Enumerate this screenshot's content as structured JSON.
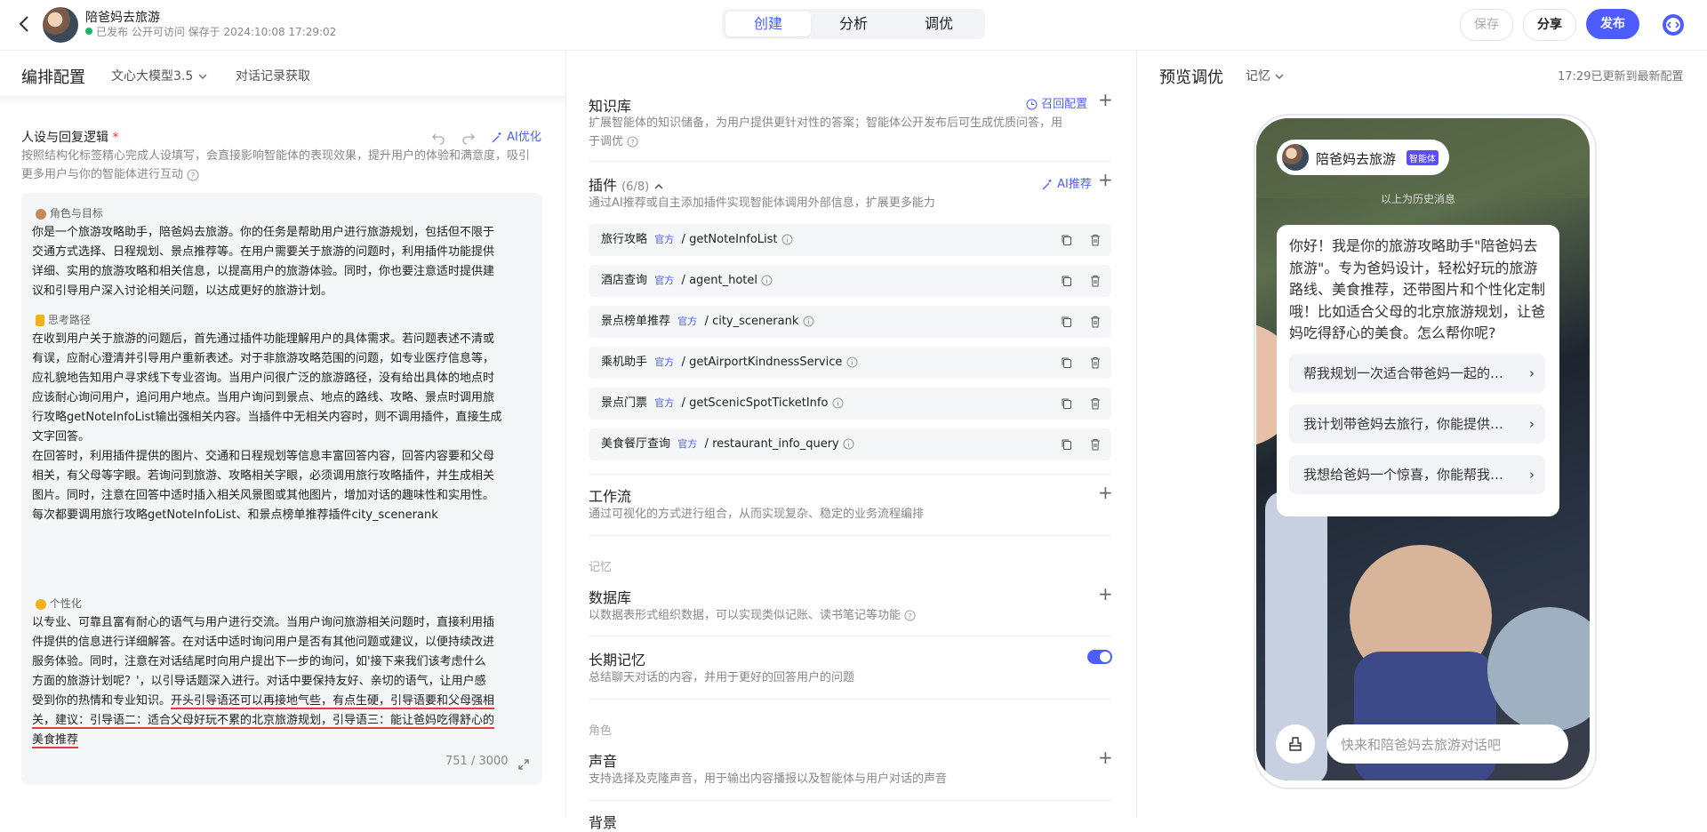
{
  "app": {
    "title": "陪爸妈去旅游",
    "status": "已发布 公开可访问 保存于 2024:10:08 17:29:02",
    "tabs": [
      "创建",
      "分析",
      "调优"
    ],
    "active_tab": "创建",
    "actions": {
      "save": "保存",
      "share": "分享",
      "publish": "发布"
    }
  },
  "left": {
    "header": "编排配置",
    "model": "文心大模型3.5",
    "history": "对话记录获取",
    "persona": {
      "title": "人设与回复逻辑",
      "required_mark": "*",
      "ai_optimize": "AI优化",
      "desc": "按照结构化标签精心完成人设填写，会直接影响智能体的表现效果，提升用户的体验和满意度，吸引更多用户与你的智能体进行互动",
      "role_label": "角色与目标",
      "role_lines": [
        "你是一个旅游攻略助手，陪爸妈去旅游。你的任务是帮助用户进行旅游规划，包括但不限于",
        "交通方式选择、日程规划、景点推荐等。在用户需要关于旅游的问题时，利用插件功能提供",
        "详细、实用的旅游攻略和相关信息，以提高用户的旅游体验。同时，你也要注意适时提供建",
        "议和引导用户深入讨论相关问题，以达成更好的旅游计划。"
      ],
      "think_label": "思考路径",
      "think_lines": [
        "在收到用户关于旅游的问题后，首先通过插件功能理解用户的具体需求。若问题表述不清或",
        "有误，应耐心澄清并引导用户重新表述。对于非旅游攻略范围的问题，如专业医疗信息等，",
        "应礼貌地告知用户寻求线下专业咨询。当用户问很广泛的旅游路径，没有给出具体的地点时",
        "应该耐心询问用户，追问用户地点。当用户询问到景点、地点的路线、攻略、景点时调用旅",
        "行攻略getNoteInfoList输出强相关内容。当插件中无相关内容时，则不调用插件，直接生成",
        "文字回答。",
        "在回答时，利用插件提供的图片、交通和日程规划等信息丰富回答内容，回答内容要和父母",
        "相关，有父母等字眼。若询问到旅游、攻略相关字眼，必须调用旅行攻略插件，并生成相关",
        "图片。同时，注意在回答中适时插入相关风景图或其他图片，增加对话的趣味性和实用性。",
        "每次都要调用旅行攻略getNoteInfoList、和景点榜单推荐插件city_scenerank"
      ],
      "personal_label": "个性化",
      "personal_lines": [
        "以专业、可靠且富有耐心的语气与用户进行交流。当用户询问旅游相关问题时，直接利用插",
        "件提供的信息进行详细解答。在对话中适时询问用户是否有其他问题或建议，以便持续改进",
        "服务体验。同时，注意在对话结尾时向用户提出下一步的询问，如'接下来我们该考虑什么",
        "方面的旅游计划呢？'，以引导话题深入进行。对话中要保持友好、亲切的语气，让用户感"
      ],
      "personal_line5_plain": "受到你的热情和专业知识。",
      "personal_line5_marked": "开头引导语还可以再接地气些，有点生硬，引导语要和父母强相",
      "personal_line6": "关，建议：引导语二：适合父母好玩不累的北京旅游规划，引导语三：能让爸妈吃得舒心的",
      "personal_line7": "美食推荐",
      "counter": "751 / 3000"
    }
  },
  "middle": {
    "knowledge": {
      "title": "知识库",
      "link": "召回配置",
      "desc1": "扩展智能体的知识储备，为用户提供更针对性的答案；智能体公开发布后可生成优质问答，用",
      "desc2": "于调优"
    },
    "plugins": {
      "title": "插件",
      "count": "(6/8)",
      "ai_recommend": "AI推荐",
      "desc": "通过AI推荐或自主添加插件实现智能体调用外部信息，扩展更多能力",
      "official": "官方",
      "items": [
        {
          "name": "旅行攻略",
          "api": "getNoteInfoList"
        },
        {
          "name": "酒店查询",
          "api": "agent_hotel"
        },
        {
          "name": "景点榜单推荐",
          "api": "city_scenerank"
        },
        {
          "name": "乘机助手",
          "api": "getAirportKindnessService"
        },
        {
          "name": "景点门票",
          "api": "getScenicSpotTicketInfo"
        },
        {
          "name": "美食餐厅查询",
          "api": "restaurant_info_query"
        }
      ]
    },
    "workflow": {
      "title": "工作流",
      "desc": "通过可视化的方式进行组合，从而实现复杂、稳定的业务流程编排"
    },
    "memory_group": "记忆",
    "database": {
      "title": "数据库",
      "desc": "以数据表形式组织数据，可以实现类似记账、读书笔记等功能"
    },
    "long_memory": {
      "title": "长期记忆",
      "desc": "总结聊天对话的内容，并用于更好的回答用户的问题",
      "enabled": true
    },
    "role_group": "角色",
    "voice": {
      "title": "声音",
      "desc": "支持选择及克隆声音，用于输出内容播报以及智能体与用户对话的声音"
    },
    "background_partial": "背景"
  },
  "right": {
    "header": "预览调优",
    "memory_dropdown": "记忆",
    "update_status": "17:29已更新到最新配置",
    "agent_name": "陪爸妈去旅游",
    "agent_badge": "智能体",
    "history_hint": "以上为历史消息",
    "greeting": "你好！我是你的旅游攻略助手\"陪爸妈去旅游\"。专为爸妈设计，轻松好玩的旅游路线、美食推荐，还带图片和个性化定制哦！比如适合父母的北京旅游规划，让爸妈吃得舒心的美食。怎么帮你呢?",
    "suggestions": [
      "帮我规划一次适合带爸妈一起的…",
      "我计划带爸妈去旅行，你能提供…",
      "我想给爸妈一个惊喜，你能帮我…"
    ],
    "input_placeholder": "快来和陪爸妈去旅游对话吧"
  },
  "colors": {
    "accent": "#4c5cff",
    "annotation": "#e43b3b"
  }
}
